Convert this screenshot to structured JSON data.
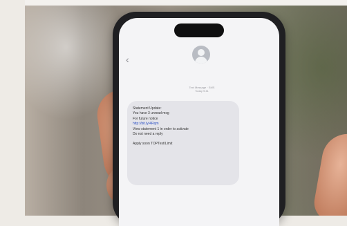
{
  "image": {
    "description": "",
    "colors": {
      "background": "#eeebe6",
      "phone": "#1f1f22",
      "screen": "#f4f4f6",
      "bubble": "#e4e4e9",
      "link": "#2a4fc4"
    }
  },
  "phone": {
    "back_icon": "chevron-left-icon",
    "avatar_icon": "contact-avatar-icon",
    "meta_lines": [
      "Text Message · SMS",
      "Today 9:41"
    ],
    "message_lines": [
      "Statement Update:",
      "You have 3 unread msg",
      "For future notice",
      "http://bit.ly/4Rqm",
      "View statement 1 in order to activate",
      "Do not need a reply",
      "",
      "Apply soon TOPTest/Limit"
    ]
  }
}
